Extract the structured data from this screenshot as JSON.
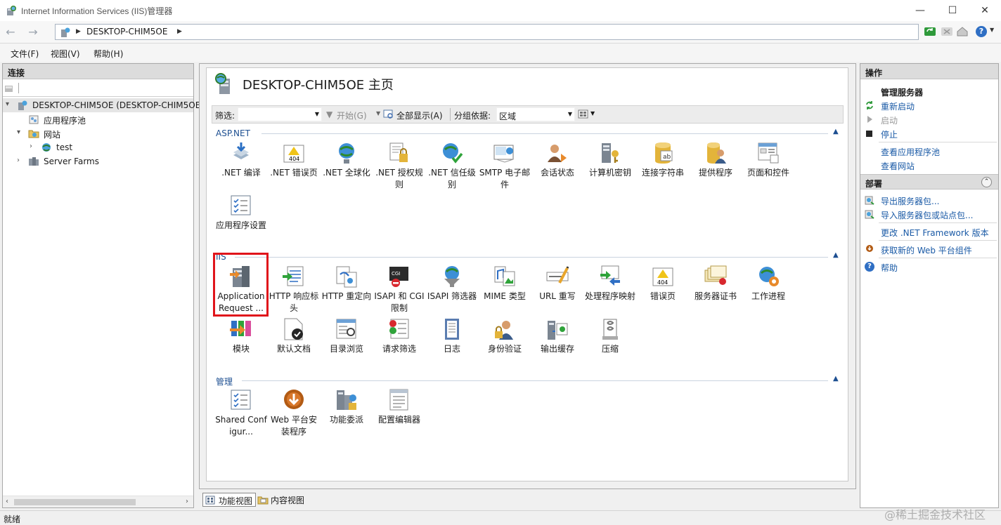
{
  "window": {
    "title": "Internet Information Services (IIS)管理器",
    "minimize": "—",
    "maximize": "☐",
    "close": "✕"
  },
  "address": {
    "path": "DESKTOP-CHIM5OE",
    "back": "←",
    "forward": "→",
    "help": "?"
  },
  "menu": [
    "文件(F)",
    "视图(V)",
    "帮助(H)"
  ],
  "connections": {
    "title": "连接",
    "tree": [
      {
        "label": "DESKTOP-CHIM5OE (DESKTOP-CHIM5OE",
        "arrow": "▾",
        "icon": "server-icon"
      },
      {
        "label": "应用程序池",
        "arrow": "",
        "icon": "app-pool-icon"
      },
      {
        "label": "网站",
        "arrow": "▾",
        "icon": "sites-folder-icon"
      },
      {
        "label": "test",
        "arrow": "›",
        "icon": "globe-icon"
      },
      {
        "label": "Server Farms",
        "arrow": "›",
        "icon": "server-farm-icon"
      }
    ]
  },
  "center": {
    "title": "DESKTOP-CHIM5OE 主页",
    "filter_label": "筛选:",
    "start_label": "开始(G)",
    "show_all_label": "全部显示(A)",
    "group_by_label": "分组依据:",
    "group_by_value": "区域",
    "groups": [
      {
        "name": "ASP.NET",
        "features": [
          {
            "label": ".NET 编译",
            "icon": "dotnet-compile-icon"
          },
          {
            "label": ".NET 错误页",
            "icon": "dotnet-error-page-icon"
          },
          {
            "label": ".NET 全球化",
            "icon": "dotnet-globalization-icon"
          },
          {
            "label": ".NET 授权规则",
            "icon": "dotnet-authorization-icon"
          },
          {
            "label": ".NET 信任级别",
            "icon": "dotnet-trust-level-icon"
          },
          {
            "label": "SMTP 电子邮件",
            "icon": "smtp-email-icon"
          },
          {
            "label": "会话状态",
            "icon": "session-state-icon"
          },
          {
            "label": "计算机密钥",
            "icon": "machine-key-icon"
          },
          {
            "label": "连接字符串",
            "icon": "connection-strings-icon"
          },
          {
            "label": "提供程序",
            "icon": "providers-icon"
          },
          {
            "label": "页面和控件",
            "icon": "pages-controls-icon"
          },
          {
            "label": "应用程序设置",
            "icon": "app-settings-icon"
          }
        ]
      },
      {
        "name": "IIS",
        "features": [
          {
            "label": "Application Request ...",
            "icon": "arr-icon"
          },
          {
            "label": "HTTP 响应标头",
            "icon": "http-headers-icon"
          },
          {
            "label": "HTTP 重定向",
            "icon": "http-redirect-icon"
          },
          {
            "label": "ISAPI 和 CGI 限制",
            "icon": "isapi-cgi-icon"
          },
          {
            "label": "ISAPI 筛选器",
            "icon": "isapi-filter-icon"
          },
          {
            "label": "MIME 类型",
            "icon": "mime-types-icon"
          },
          {
            "label": "URL 重写",
            "icon": "url-rewrite-icon"
          },
          {
            "label": "处理程序映射",
            "icon": "handler-mappings-icon"
          },
          {
            "label": "错误页",
            "icon": "error-pages-icon"
          },
          {
            "label": "服务器证书",
            "icon": "server-certificates-icon"
          },
          {
            "label": "工作进程",
            "icon": "worker-processes-icon"
          },
          {
            "label": "模块",
            "icon": "modules-icon"
          },
          {
            "label": "默认文档",
            "icon": "default-document-icon"
          },
          {
            "label": "目录浏览",
            "icon": "directory-browsing-icon"
          },
          {
            "label": "请求筛选",
            "icon": "request-filtering-icon"
          },
          {
            "label": "日志",
            "icon": "logging-icon"
          },
          {
            "label": "身份验证",
            "icon": "authentication-icon"
          },
          {
            "label": "输出缓存",
            "icon": "output-caching-icon"
          },
          {
            "label": "压缩",
            "icon": "compression-icon"
          }
        ]
      },
      {
        "name": "管理",
        "features": [
          {
            "label": "Shared Configur...",
            "icon": "shared-config-icon"
          },
          {
            "label": "Web 平台安装程序",
            "icon": "web-platform-installer-icon"
          },
          {
            "label": "功能委派",
            "icon": "feature-delegation-icon"
          },
          {
            "label": "配置编辑器",
            "icon": "config-editor-icon"
          }
        ]
      }
    ],
    "highlight_color": "#e0141b"
  },
  "actions": {
    "title": "操作",
    "manage_server_title": "管理服务器",
    "manage_items": [
      {
        "label": "重新启动",
        "enabled": true,
        "icon": "restart-icon"
      },
      {
        "label": "启动",
        "enabled": false,
        "icon": "start-icon"
      },
      {
        "label": "停止",
        "enabled": true,
        "icon": "stop-icon"
      }
    ],
    "view_items": [
      "查看应用程序池",
      "查看网站"
    ],
    "deploy_title": "部署",
    "deploy_items": [
      {
        "label": "导出服务器包...",
        "icon": "export-package-icon"
      },
      {
        "label": "导入服务器包或站点包...",
        "icon": "import-package-icon"
      }
    ],
    "change_framework": "更改 .NET Framework 版本",
    "get_web_components": "获取新的 Web 平台组件",
    "help": "帮助"
  },
  "bottom_tabs": [
    "功能视图",
    "内容视图"
  ],
  "status": "就绪",
  "watermark": "@稀土掘金技术社区"
}
